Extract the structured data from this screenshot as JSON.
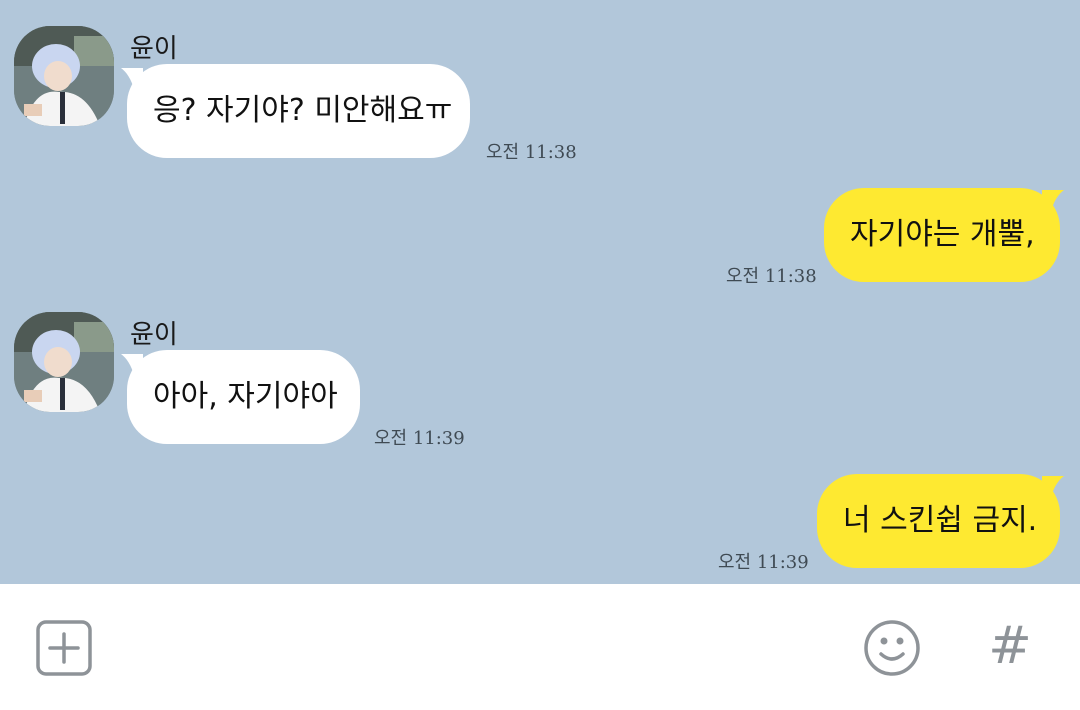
{
  "messages": [
    {
      "direction": "in",
      "sender": "윤이",
      "text": "응? 자기야? 미안해요ㅠ",
      "time": "오전 11:38"
    },
    {
      "direction": "out",
      "text": "자기야는 개뿔,",
      "time": "오전 11:38"
    },
    {
      "direction": "in",
      "sender": "윤이",
      "text": "아아, 자기야아",
      "time": "오전 11:39"
    },
    {
      "direction": "out",
      "text": "너 스킨쉽 금지.",
      "time": "오전 11:39"
    }
  ],
  "input_bar": {
    "icons": [
      "plus-square-icon",
      "emoji-icon",
      "hashtag-icon"
    ],
    "hashtag_glyph": "#"
  },
  "colors": {
    "chat_background": "#b2c7da",
    "incoming_bubble": "#ffffff",
    "outgoing_bubble": "#fee931",
    "icon_gray": "#8e9398"
  }
}
